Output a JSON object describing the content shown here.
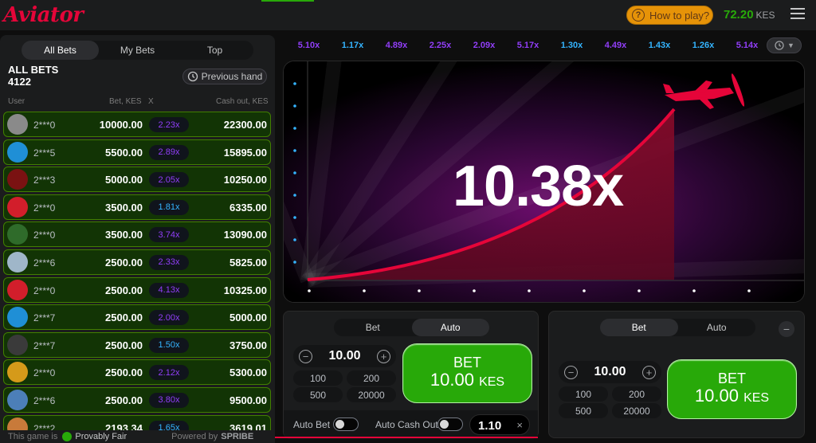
{
  "header": {
    "logo": "Aviator",
    "how_to_play": "How to play?",
    "balance": "72.20",
    "currency": "KES"
  },
  "left_panel": {
    "tabs": [
      "All Bets",
      "My Bets",
      "Top"
    ],
    "active_tab": "All Bets",
    "title": "ALL BETS",
    "count": "4122",
    "previous_hand": "Previous hand",
    "columns": {
      "user": "User",
      "bet": "Bet, KES",
      "x": "X",
      "cashout": "Cash out, KES"
    },
    "rows": [
      {
        "user": "2***0",
        "bet": "10000.00",
        "mult": "2.23x",
        "mult_color": "#913ef8",
        "cashout": "22300.00",
        "avatar_color": "#8a8a8a"
      },
      {
        "user": "2***5",
        "bet": "5500.00",
        "mult": "2.89x",
        "mult_color": "#913ef8",
        "cashout": "15895.00",
        "avatar_color": "#1f8fd6"
      },
      {
        "user": "2***3",
        "bet": "5000.00",
        "mult": "2.05x",
        "mult_color": "#913ef8",
        "cashout": "10250.00",
        "avatar_color": "#7a1212"
      },
      {
        "user": "2***0",
        "bet": "3500.00",
        "mult": "1.81x",
        "mult_color": "#34b4ff",
        "cashout": "6335.00",
        "avatar_color": "#d21e2b"
      },
      {
        "user": "2***0",
        "bet": "3500.00",
        "mult": "3.74x",
        "mult_color": "#913ef8",
        "cashout": "13090.00",
        "avatar_color": "#2f6b2a"
      },
      {
        "user": "2***6",
        "bet": "2500.00",
        "mult": "2.33x",
        "mult_color": "#913ef8",
        "cashout": "5825.00",
        "avatar_color": "#9fb6c9"
      },
      {
        "user": "2***0",
        "bet": "2500.00",
        "mult": "4.13x",
        "mult_color": "#913ef8",
        "cashout": "10325.00",
        "avatar_color": "#d21e2b"
      },
      {
        "user": "2***7",
        "bet": "2500.00",
        "mult": "2.00x",
        "mult_color": "#913ef8",
        "cashout": "5000.00",
        "avatar_color": "#1f8fd6"
      },
      {
        "user": "2***7",
        "bet": "2500.00",
        "mult": "1.50x",
        "mult_color": "#34b4ff",
        "cashout": "3750.00",
        "avatar_color": "#3a3a3a"
      },
      {
        "user": "2***0",
        "bet": "2500.00",
        "mult": "2.12x",
        "mult_color": "#913ef8",
        "cashout": "5300.00",
        "avatar_color": "#d59a1a"
      },
      {
        "user": "2***6",
        "bet": "2500.00",
        "mult": "3.80x",
        "mult_color": "#913ef8",
        "cashout": "9500.00",
        "avatar_color": "#4c7fb8"
      },
      {
        "user": "2***2",
        "bet": "2193.34",
        "mult": "1.65x",
        "mult_color": "#34b4ff",
        "cashout": "3619.01",
        "avatar_color": "#c87a3a"
      }
    ],
    "footer_left": "This game is",
    "provably_fair": "Provably Fair",
    "powered_by": "Powered by",
    "spribe": "SPRIBE"
  },
  "history": [
    {
      "v": "5.10x",
      "color": "#913ef8"
    },
    {
      "v": "1.17x",
      "color": "#34b4ff"
    },
    {
      "v": "4.89x",
      "color": "#913ef8"
    },
    {
      "v": "2.25x",
      "color": "#913ef8"
    },
    {
      "v": "2.09x",
      "color": "#913ef8"
    },
    {
      "v": "5.17x",
      "color": "#913ef8"
    },
    {
      "v": "1.30x",
      "color": "#34b4ff"
    },
    {
      "v": "4.49x",
      "color": "#913ef8"
    },
    {
      "v": "1.43x",
      "color": "#34b4ff"
    },
    {
      "v": "1.26x",
      "color": "#34b4ff"
    },
    {
      "v": "5.14x",
      "color": "#913ef8"
    }
  ],
  "game": {
    "multiplier": "10.38x"
  },
  "bet_panel_1": {
    "tabs": [
      "Bet",
      "Auto"
    ],
    "active_tab": "Auto",
    "amount": "10.00",
    "quick": [
      "100",
      "200",
      "500",
      "20000"
    ],
    "bet_label": "BET",
    "bet_amount": "10.00",
    "bet_currency": "KES",
    "auto_bet": "Auto Bet",
    "auto_cashout": "Auto Cash Out",
    "cashout_value": "1.10",
    "clear": "×"
  },
  "bet_panel_2": {
    "tabs": [
      "Bet",
      "Auto"
    ],
    "active_tab": "Bet",
    "amount": "10.00",
    "quick": [
      "100",
      "200",
      "500",
      "20000"
    ],
    "bet_label": "BET",
    "bet_amount": "10.00",
    "bet_currency": "KES",
    "remove": "−"
  }
}
